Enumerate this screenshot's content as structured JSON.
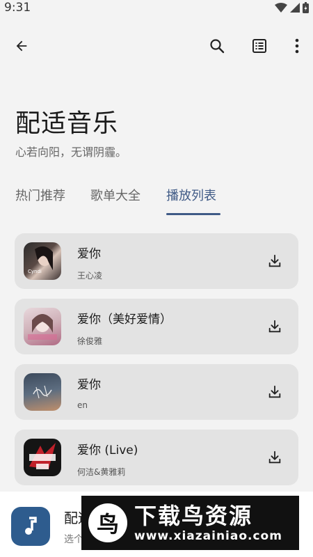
{
  "status": {
    "time": "9:31"
  },
  "header": {
    "title": "配适音乐",
    "subtitle": "心若向阳，无谓阴霾。"
  },
  "tabs": [
    {
      "label": "热门推荐",
      "active": false
    },
    {
      "label": "歌单大全",
      "active": false
    },
    {
      "label": "播放列表",
      "active": true
    }
  ],
  "songs": [
    {
      "title": "爱你",
      "artist": "王心凌"
    },
    {
      "title": "爱你（美好爱情）",
      "artist": "徐俊雅"
    },
    {
      "title": "爱你",
      "artist": "en"
    },
    {
      "title": "爱你 (Live)",
      "artist": "何洁&黄雅莉"
    }
  ],
  "player": {
    "title": "配适",
    "subtitle": "选个"
  },
  "watermark": {
    "brand": "下载鸟资源",
    "url": "www.xiazainiao.com"
  },
  "colors": {
    "accent": "#3f5a86",
    "card": "#e3e3e3",
    "background": "#f3f3f3"
  },
  "icons": [
    "back-arrow-icon",
    "search-icon",
    "list-icon",
    "more-icon",
    "download-icon",
    "music-note-icon"
  ]
}
